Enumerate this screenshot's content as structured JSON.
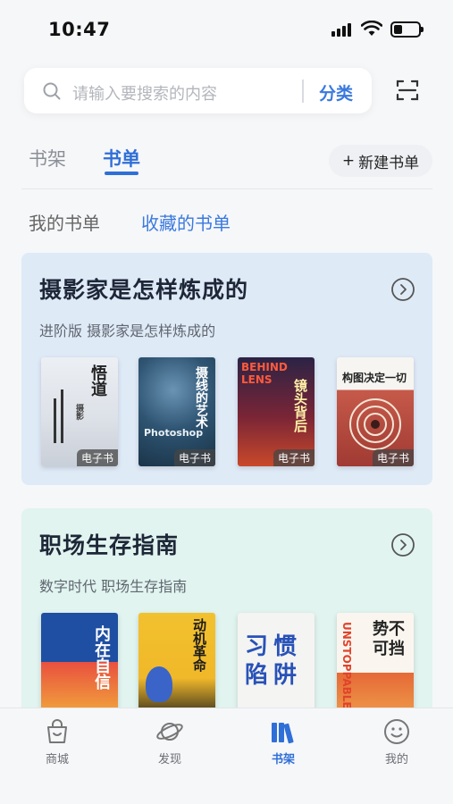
{
  "status": {
    "time": "10:47",
    "battery_level": 0.35
  },
  "search": {
    "placeholder": "请输入要搜索的内容",
    "category_label": "分类"
  },
  "tabs": {
    "shelf": "书架",
    "booklist": "书单",
    "new_list": "新建书单",
    "plus": "+"
  },
  "subtabs": {
    "mine": "我的书单",
    "favorites": "收藏的书单"
  },
  "cards": [
    {
      "title": "摄影家是怎样炼成的",
      "subtitle": "进阶版 摄影家是怎样炼成的",
      "books": [
        {
          "cover_text": "悟道",
          "sub": "摄影",
          "tag": "电子书"
        },
        {
          "cover_text": "摄线的艺术",
          "sub": "Photoshop",
          "tag": "电子书"
        },
        {
          "cover_text": "镜头背后",
          "sub": "BEHIND LENS",
          "tag": "电子书"
        },
        {
          "cover_text": "构图决定一切",
          "sub": "",
          "tag": "电子书"
        }
      ]
    },
    {
      "title": "职场生存指南",
      "subtitle": "数字时代 职场生存指南",
      "books": [
        {
          "cover_text": "内在自信",
          "sub": ""
        },
        {
          "cover_text": "动机革命",
          "sub": ""
        },
        {
          "cover_text": "习惯陷阱",
          "sub": ""
        },
        {
          "cover_text": "势不可挡",
          "sub": "UNSTOPPABLE"
        }
      ]
    }
  ],
  "nav": [
    {
      "label": "商城",
      "icon": "bag-icon"
    },
    {
      "label": "发现",
      "icon": "planet-icon"
    },
    {
      "label": "书架",
      "icon": "books-icon",
      "active": true
    },
    {
      "label": "我的",
      "icon": "smile-icon"
    }
  ],
  "colors": {
    "accent": "#2f6fd8",
    "card1_bg": "#dfeaf7",
    "card2_bg": "#e1f4ef"
  }
}
